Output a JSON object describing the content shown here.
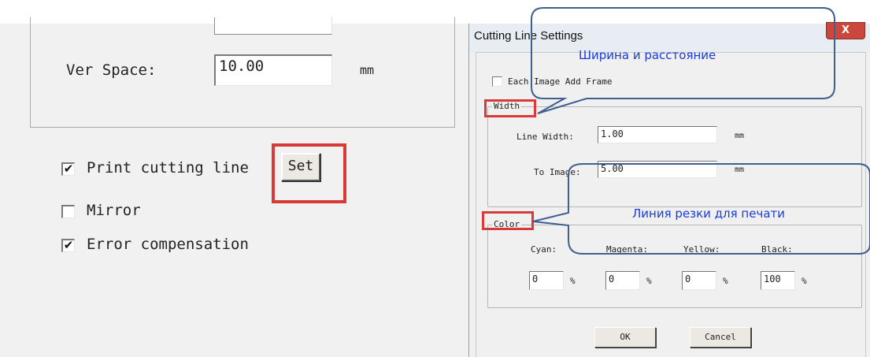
{
  "main_panel": {
    "ver_space_label": "Ver Space:",
    "ver_space_value": "10.00",
    "ver_space_unit": "mm",
    "print_cutting_line": {
      "label": "Print cutting line",
      "checked": true,
      "check_mark": "✔"
    },
    "set_button_label": "Set",
    "mirror": {
      "label": "Mirror",
      "checked": false
    },
    "error_compensation": {
      "label": "Error compensation",
      "checked": true,
      "check_mark": "✔"
    }
  },
  "dialog": {
    "title": "Cutting Line Settings",
    "close_label": "X",
    "each_image_add_frame": {
      "label": "Each Image Add Frame",
      "checked": false
    },
    "width_group": {
      "legend": "Width",
      "line_width_label": "Line Width:",
      "line_width_value": "1.00",
      "line_width_unit": "mm",
      "to_image_label": "To Image:",
      "to_image_value": "5.00",
      "to_image_unit": "mm"
    },
    "color_group": {
      "legend": "Color",
      "channels": [
        {
          "label": "Cyan:",
          "value": "0"
        },
        {
          "label": "Magenta:",
          "value": "0"
        },
        {
          "label": "Yellow:",
          "value": "0"
        },
        {
          "label": "Black:",
          "value": "100"
        }
      ],
      "percent_sign": "%"
    },
    "ok_label": "OK",
    "cancel_label": "Cancel"
  },
  "annotations": {
    "width_callout": "Ширина и расстояние",
    "color_callout": "Линия резки для печати",
    "highlight_color": "#d83a3a",
    "callout_line_color": "#3f5f8f",
    "callout_text_color": "#1a3bd8"
  }
}
